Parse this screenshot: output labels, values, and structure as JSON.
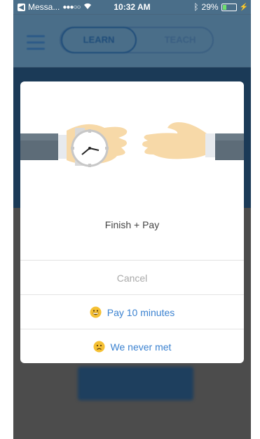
{
  "status_bar": {
    "carrier": "Messa...",
    "signal": "●●●○○",
    "time": "10:32 AM",
    "battery": "29%",
    "battery_level": 0.29
  },
  "header": {
    "tabs": [
      "LEARN",
      "TEACH"
    ],
    "active_tab": "LEARN"
  },
  "modal": {
    "title": "Finish + Pay",
    "actions": {
      "cancel": "Cancel",
      "pay": "Pay 10 minutes",
      "never_met": "We never met"
    }
  },
  "colors": {
    "accent": "#3b82d0",
    "muted": "#a9a9a9",
    "header_bg": "#4a6e89"
  }
}
